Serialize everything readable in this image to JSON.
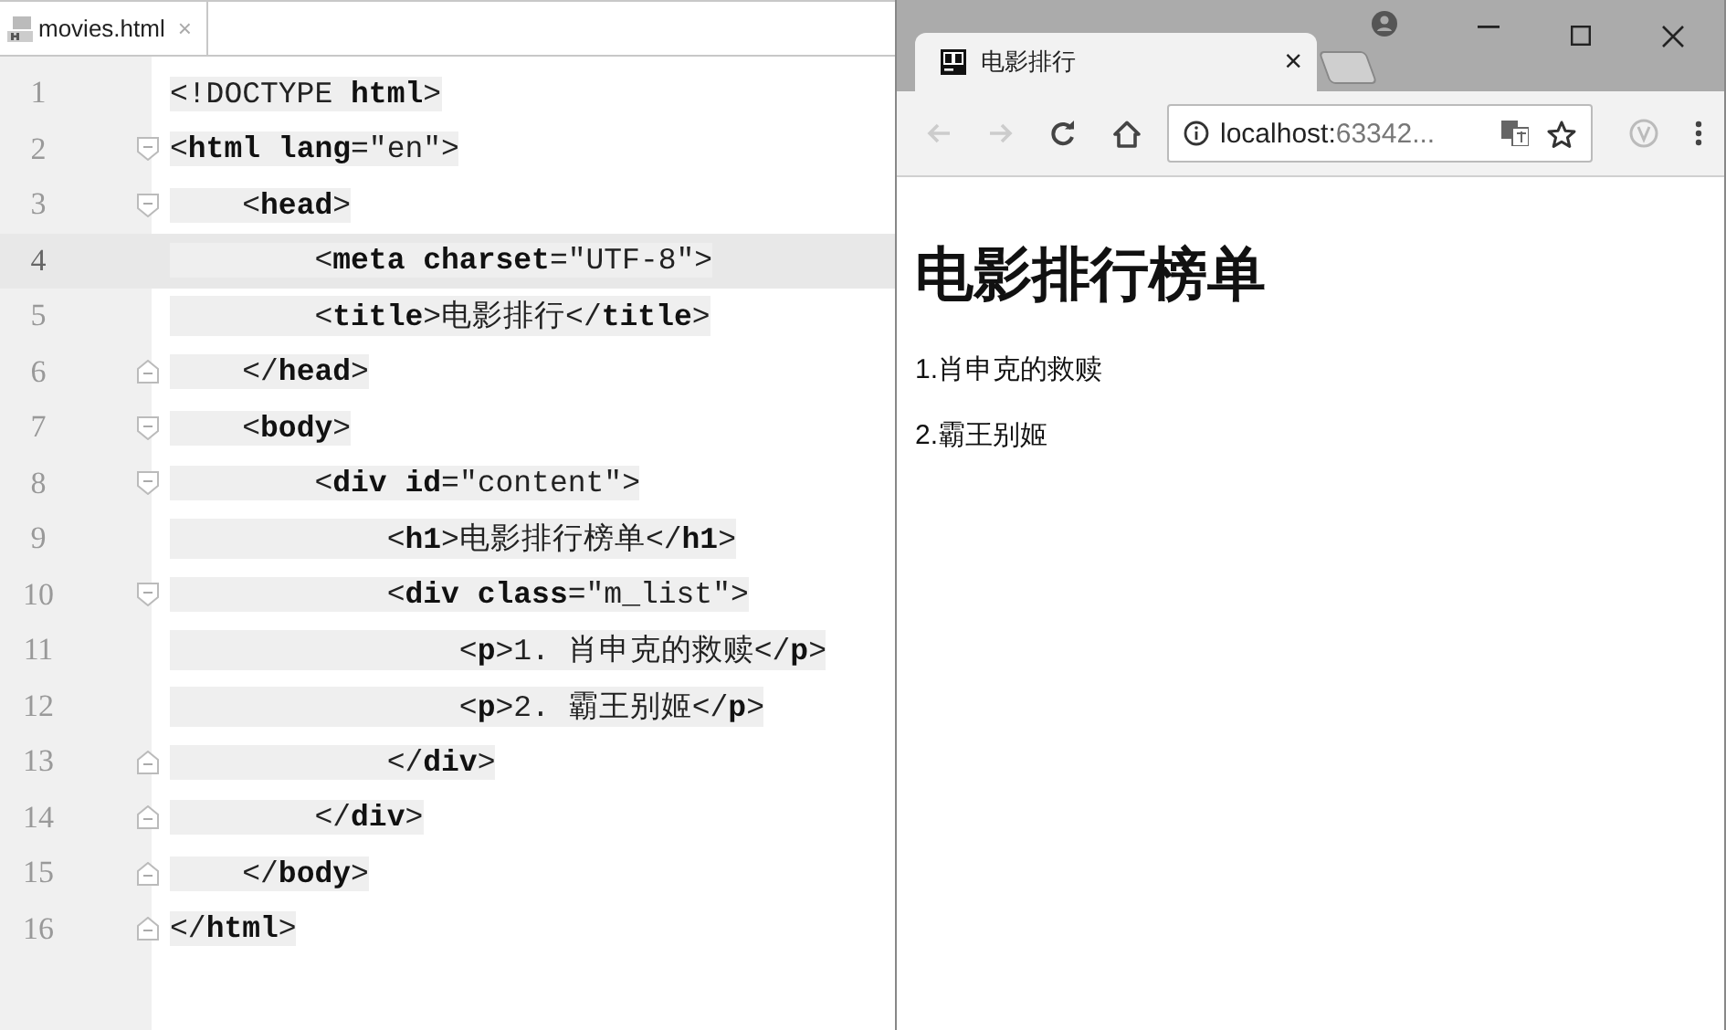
{
  "editor": {
    "tab": {
      "label": "movies.html",
      "close": "×",
      "selected": true
    },
    "lines": [
      {
        "number": "1",
        "code": "<!DOCTYPE **html**>",
        "kind": "plain",
        "current": false
      },
      {
        "number": "2",
        "code": "<**html lang**=\"en\">",
        "kind": "open",
        "current": false
      },
      {
        "number": "3",
        "code": "    <**head**>",
        "kind": "open",
        "current": false
      },
      {
        "number": "4",
        "code": "        <**meta charset**=\"UTF-8\">",
        "kind": "plain",
        "current": true
      },
      {
        "number": "5",
        "code": "        <**title**>电影排行</**title**>",
        "kind": "plain",
        "current": false
      },
      {
        "number": "6",
        "code": "    </**head**>",
        "kind": "close",
        "current": false
      },
      {
        "number": "7",
        "code": "    <**body**>",
        "kind": "open",
        "current": false
      },
      {
        "number": "8",
        "code": "        <**div id**=\"content\">",
        "kind": "open",
        "current": false
      },
      {
        "number": "9",
        "code": "            <**h1**>电影排行榜单</**h1**>",
        "kind": "plain",
        "current": false
      },
      {
        "number": "10",
        "code": "            <**div class**=\"m_list\">",
        "kind": "open",
        "current": false
      },
      {
        "number": "11",
        "code": "                <**p**>1. 肖申克的救赎</**p**>",
        "kind": "plain",
        "current": false
      },
      {
        "number": "12",
        "code": "                <**p**>2. 霸王别姬</**p**>",
        "kind": "plain",
        "current": false
      },
      {
        "number": "13",
        "code": "            </**div**>",
        "kind": "close",
        "current": false
      },
      {
        "number": "14",
        "code": "        </**div**>",
        "kind": "close",
        "current": false
      },
      {
        "number": "15",
        "code": "    </**body**>",
        "kind": "close",
        "current": false
      },
      {
        "number": "16",
        "code": "</**html**>",
        "kind": "close",
        "current": false
      }
    ]
  },
  "browser": {
    "tab": {
      "title": "电影排行",
      "close": "×",
      "selected": true
    },
    "address": {
      "host": "localhost:",
      "rest": "63342..."
    },
    "page": {
      "heading": "电影排行榜单",
      "paragraphs": [
        "1.肖申克的救赎",
        "2.霸王别姬"
      ]
    }
  }
}
